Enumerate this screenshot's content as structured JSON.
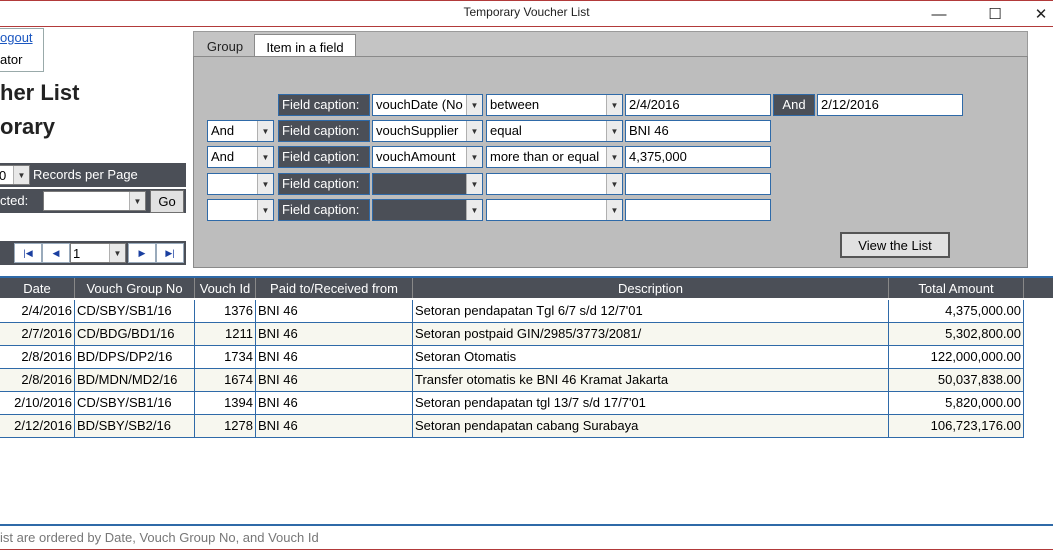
{
  "window": {
    "title": "Temporary Voucher List",
    "minimize_glyph": "—",
    "maximize_glyph": "☐",
    "close_glyph": "✕"
  },
  "user": {
    "logout_label": "ogout",
    "role": "ator"
  },
  "page": {
    "title_line1": "her List",
    "title_line2": "orary"
  },
  "paging": {
    "records_per_page_value": "0",
    "records_per_page_label": "Records per Page",
    "selected_label": "cted:",
    "selected_value": "",
    "go_label": "Go",
    "page_value": "1"
  },
  "filter": {
    "tabs": [
      "Group",
      "Item in a field"
    ],
    "active_tab": 1,
    "rows": [
      {
        "conj": "",
        "caption": "Field caption:",
        "field": "vouchDate (No",
        "op": "between",
        "value": "2/4/2016",
        "and_label": "And",
        "value2": "2/12/2016"
      },
      {
        "conj": "And",
        "caption": "Field caption:",
        "field": "vouchSupplier",
        "op": "equal",
        "value": "BNI 46"
      },
      {
        "conj": "And",
        "caption": "Field caption:",
        "field": "vouchAmount",
        "op": "more than or equal",
        "value": "4,375,000"
      },
      {
        "conj": "",
        "caption": "Field caption:",
        "field": "",
        "op": "",
        "value": ""
      },
      {
        "conj": "",
        "caption": "Field caption:",
        "field": "",
        "op": "",
        "value": ""
      }
    ],
    "view_list_label": "View the List"
  },
  "table": {
    "columns": [
      "Date",
      "Vouch Group No",
      "Vouch Id",
      "Paid to/Received from",
      "Description",
      "Total Amount"
    ],
    "rows": [
      [
        "2/4/2016",
        "CD/SBY/SB1/16",
        "1376",
        "BNI 46",
        "Setoran pendapatan Tgl 6/7 s/d 12/7'01",
        "4,375,000.00"
      ],
      [
        "2/7/2016",
        "CD/BDG/BD1/16",
        "1211",
        "BNI 46",
        "Setoran postpaid GIN/2985/3773/2081/",
        "5,302,800.00"
      ],
      [
        "2/8/2016",
        "BD/DPS/DP2/16",
        "1734",
        "BNI 46",
        "Setoran Otomatis",
        "122,000,000.00"
      ],
      [
        "2/8/2016",
        "BD/MDN/MD2/16",
        "1674",
        "BNI 46",
        "Transfer otomatis ke BNI 46 Kramat Jakarta",
        "50,037,838.00"
      ],
      [
        "2/10/2016",
        "CD/SBY/SB1/16",
        "1394",
        "BNI 46",
        "Setoran pendapatan tgl 13/7 s/d 17/7'01",
        "5,820,000.00"
      ],
      [
        "2/12/2016",
        "BD/SBY/SB2/16",
        "1278",
        "BNI 46",
        "Setoran pendapatan cabang Surabaya",
        "106,723,176.00"
      ]
    ]
  },
  "footer": {
    "note": "ist are ordered by Date, Vouch Group No, and Vouch Id"
  }
}
